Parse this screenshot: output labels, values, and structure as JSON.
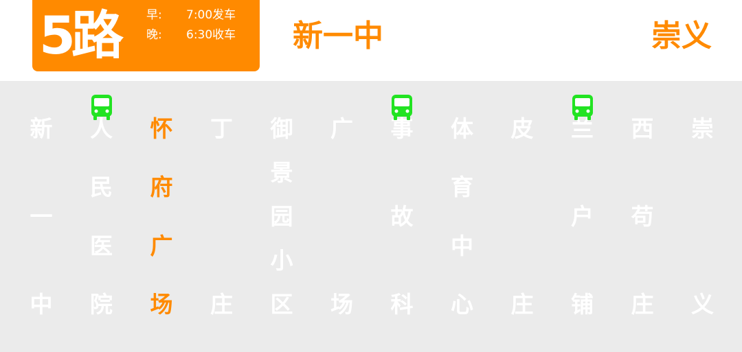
{
  "header": {
    "route_number": "5路",
    "schedule": {
      "first_label": "早:",
      "first_time": "7:00发车",
      "last_label": "晚:",
      "last_time": "6:30收车"
    },
    "origin": "新一中",
    "terminus": "崇义"
  },
  "colors": {
    "accent": "#ff8a00",
    "bus_icon": "#22e322",
    "panel_bg": "#ebebeb",
    "stop_text": "#ffffff"
  },
  "buses": [
    {
      "icon": "bus-icon",
      "at_stop_index": 1
    },
    {
      "icon": "bus-icon",
      "at_stop_index": 6
    },
    {
      "icon": "bus-icon",
      "at_stop_index": 9
    }
  ],
  "stops": [
    {
      "chars": [
        "新",
        "一",
        "中"
      ],
      "current": false
    },
    {
      "chars": [
        "人",
        "民",
        "医",
        "院"
      ],
      "current": false
    },
    {
      "chars": [
        "怀",
        "府",
        "广",
        "场"
      ],
      "current": true
    },
    {
      "chars": [
        "丁",
        "庄"
      ],
      "current": false
    },
    {
      "chars": [
        "御",
        "景",
        "园",
        "小",
        "区"
      ],
      "current": false
    },
    {
      "chars": [
        "广",
        "场"
      ],
      "current": false
    },
    {
      "chars": [
        "事",
        "故",
        "科"
      ],
      "current": false
    },
    {
      "chars": [
        "体",
        "育",
        "中",
        "心"
      ],
      "current": false
    },
    {
      "chars": [
        "皮",
        "庄"
      ],
      "current": false
    },
    {
      "chars": [
        "兰",
        "户",
        "铺"
      ],
      "current": false
    },
    {
      "chars": [
        "西",
        "苟",
        "庄"
      ],
      "current": false
    },
    {
      "chars": [
        "崇",
        "义"
      ],
      "current": false
    }
  ]
}
